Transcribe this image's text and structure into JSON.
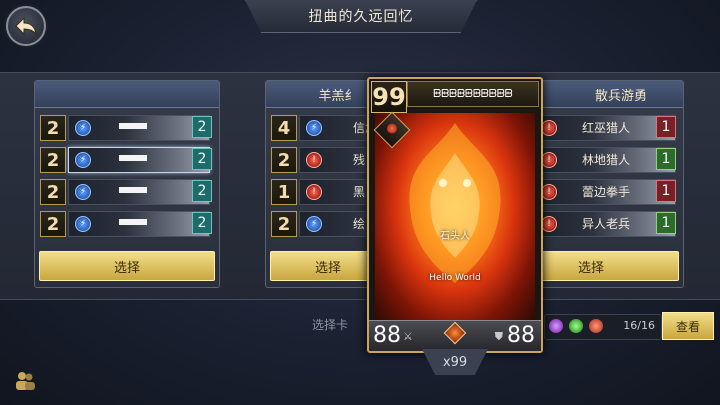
{
  "title": "扭曲的久远回忆",
  "panels": [
    {
      "header": "",
      "rows": [
        {
          "cost": "2",
          "name": "",
          "count": "2",
          "element": "blue",
          "count_style": "teal",
          "selected": false
        },
        {
          "cost": "2",
          "name": "",
          "count": "2",
          "element": "blue",
          "count_style": "teal",
          "selected": true
        },
        {
          "cost": "2",
          "name": "",
          "count": "2",
          "element": "blue",
          "count_style": "teal",
          "selected": false
        },
        {
          "cost": "2",
          "name": "",
          "count": "2",
          "element": "blue",
          "count_style": "teal",
          "selected": false
        }
      ],
      "button": "选择"
    },
    {
      "header": "羊羔纟",
      "rows": [
        {
          "cost": "4",
          "name": "信念",
          "count": "",
          "element": "blue"
        },
        {
          "cost": "2",
          "name": "残日",
          "count": "",
          "element": "red"
        },
        {
          "cost": "1",
          "name": "黑",
          "count": "",
          "element": "red"
        },
        {
          "cost": "2",
          "name": "绘",
          "count": "",
          "element": "blue"
        }
      ],
      "button": "选择"
    },
    {
      "header": "散兵游勇",
      "rows": [
        {
          "cost": "",
          "name": "红巫猎人",
          "count": "1",
          "element": "red",
          "count_style": "red"
        },
        {
          "cost": "",
          "name": "林地猎人",
          "count": "1",
          "element": "red",
          "count_style": "green"
        },
        {
          "cost": "",
          "name": "蕾边拳手",
          "count": "1",
          "element": "red",
          "count_style": "red"
        },
        {
          "cost": "",
          "name": "异人老兵",
          "count": "1",
          "element": "red",
          "count_style": "green"
        }
      ],
      "button": "选择"
    }
  ],
  "card": {
    "cost": "99",
    "title": "ᗸᗸᗸᗸᗸᗸᗸᗸᗸᗸ",
    "race": "石头人",
    "text": "Hello World",
    "attack": "88",
    "health": "88",
    "copies": "x99",
    "rarity_icon": "flame-rarity-icon"
  },
  "bottom": {
    "select_tab": "选择卡",
    "gem_count": "16/16",
    "view_button": "查看",
    "gem_colors": [
      "#9a3ad6",
      "#39b83a",
      "#d63a2a"
    ]
  },
  "icons": {
    "back": "back-arrow-icon",
    "friends": "friends-icon"
  }
}
